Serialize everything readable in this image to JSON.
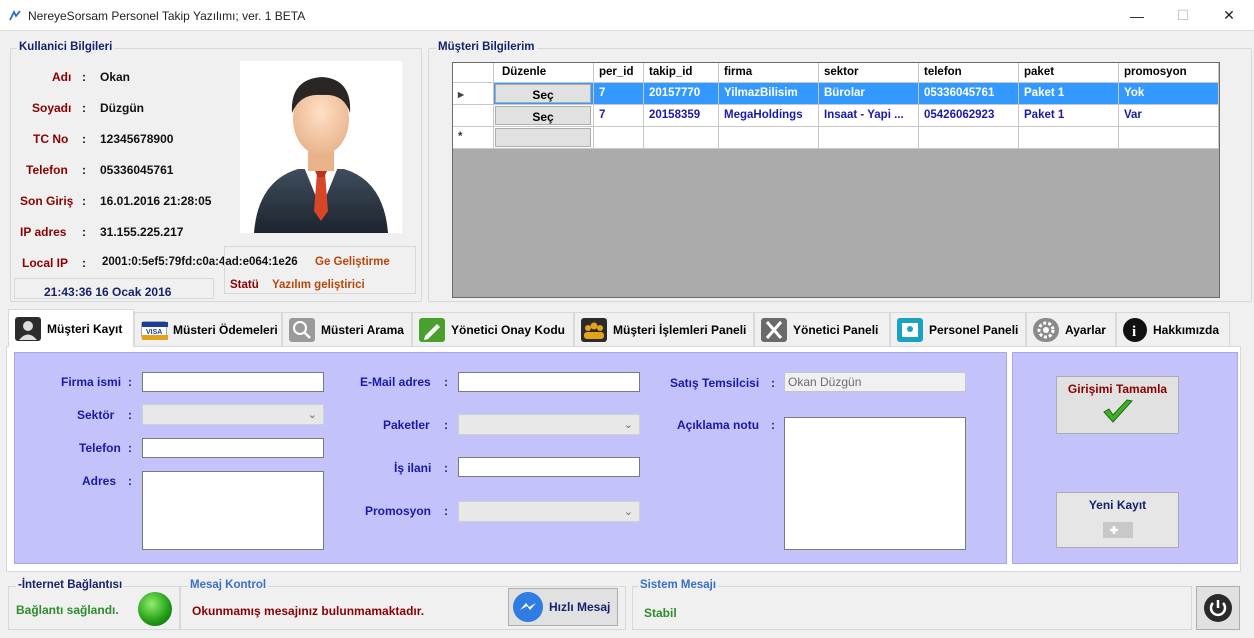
{
  "window": {
    "title": "NereyeSorsam Personel Takip Yazılımı; ver. 1 BETA",
    "minimize": "—",
    "maximize": "☐",
    "close": "✕"
  },
  "user_info": {
    "group_title": "Kullanici Bilgileri",
    "fields": [
      {
        "label": "Adı",
        "value": "Okan"
      },
      {
        "label": "Soyadı",
        "value": "Düzgün"
      },
      {
        "label": "TC No",
        "value": "12345678900"
      },
      {
        "label": "Telefon",
        "value": "05336045761"
      },
      {
        "label": "Son Giriş",
        "value": "16.01.2016 21:28:05"
      },
      {
        "label": "IP adres",
        "value": "31.155.225.217"
      },
      {
        "label": "Local IP",
        "value": "2001:0:5ef5:79fd:c0a:4ad:e064:1e26"
      }
    ],
    "role_short": "Ge Geliştirme",
    "clock": "21:43:36 16 Ocak 2016",
    "status_label": "Statü",
    "status_value": "Yazılım geliştirici"
  },
  "customers": {
    "group_title": "Müşteri Bilgilerim",
    "columns": [
      "Düzenle",
      "per_id",
      "takip_id",
      "firma",
      "sektor",
      "telefon",
      "paket",
      "promosyon"
    ],
    "rows": [
      {
        "edit": "Seç",
        "per_id": "7",
        "takip_id": "20157770",
        "firma": "YilmazBilisim",
        "sektor": "Bürolar",
        "telefon": "05336045761",
        "paket": "Paket 1",
        "promosyon": "Yok"
      },
      {
        "edit": "Seç",
        "per_id": "7",
        "takip_id": "20158359",
        "firma": "MegaHoldings",
        "sektor": "Insaat - Yapi ...",
        "telefon": "05426062923",
        "paket": "Paket 1",
        "promosyon": "Var"
      }
    ],
    "new_row_marker": "*"
  },
  "tabs": [
    {
      "label": "Müşteri Kayıt",
      "icon": "user-icon",
      "color": "#2b2b2b"
    },
    {
      "label": "Müsteri Ödemeleri",
      "icon": "visa-card-icon",
      "color": "#1a3d99"
    },
    {
      "label": "Müsteri Arama",
      "icon": "search-icon",
      "color": "#707070"
    },
    {
      "label": "Yönetici Onay Kodu",
      "icon": "edit-icon",
      "color": "#4aa02c"
    },
    {
      "label": "Müşteri İşlemleri Paneli",
      "icon": "group-icon",
      "color": "#e3a21a"
    },
    {
      "label": "Yönetici Paneli",
      "icon": "admin-icon",
      "color": "#555555"
    },
    {
      "label": "Personel Paneli",
      "icon": "staff-icon",
      "color": "#1ba1c4"
    },
    {
      "label": "Ayarlar",
      "icon": "gear-icon",
      "color": "#6a6a6a"
    },
    {
      "label": "Hakkımızda",
      "icon": "info-icon",
      "color": "#111111"
    }
  ],
  "form": {
    "firma_isim": {
      "label": "Firma ismi",
      "value": ""
    },
    "sektor": {
      "label": "Sektör",
      "value": ""
    },
    "telefon": {
      "label": "Telefon",
      "value": ""
    },
    "adres": {
      "label": "Adres",
      "value": ""
    },
    "email": {
      "label": "E-Mail adres",
      "value": ""
    },
    "paketler": {
      "label": "Paketler",
      "value": ""
    },
    "is_ilani": {
      "label": "İş ilani",
      "value": ""
    },
    "promosyon": {
      "label": "Promosyon",
      "value": ""
    },
    "satis": {
      "label": "Satış Temsilcisi",
      "value": "Okan Düzgün"
    },
    "aciklama": {
      "label": "Açıklama notu",
      "value": ""
    },
    "colon": ":"
  },
  "actions": {
    "complete": "Girişimi Tamamla",
    "new_record": "Yeni Kayıt"
  },
  "statusbar": {
    "internet_title": "-İnternet Bağlantısı",
    "internet_status": "Bağlantı sağlandı.",
    "message_title": "Mesaj Kontrol",
    "message_text": "Okunmamış mesajınız bulunmamaktadır.",
    "quick_message": "Hızlı Mesaj",
    "system_title": "Sistem Mesajı",
    "system_text": "Stabil"
  },
  "colors": {
    "form_bg": "#c4c2fa",
    "label_blue": "#1a1aa6",
    "label_red": "#8b0000",
    "selected_row": "#3399ff",
    "ok_green": "#2e8b2e"
  }
}
